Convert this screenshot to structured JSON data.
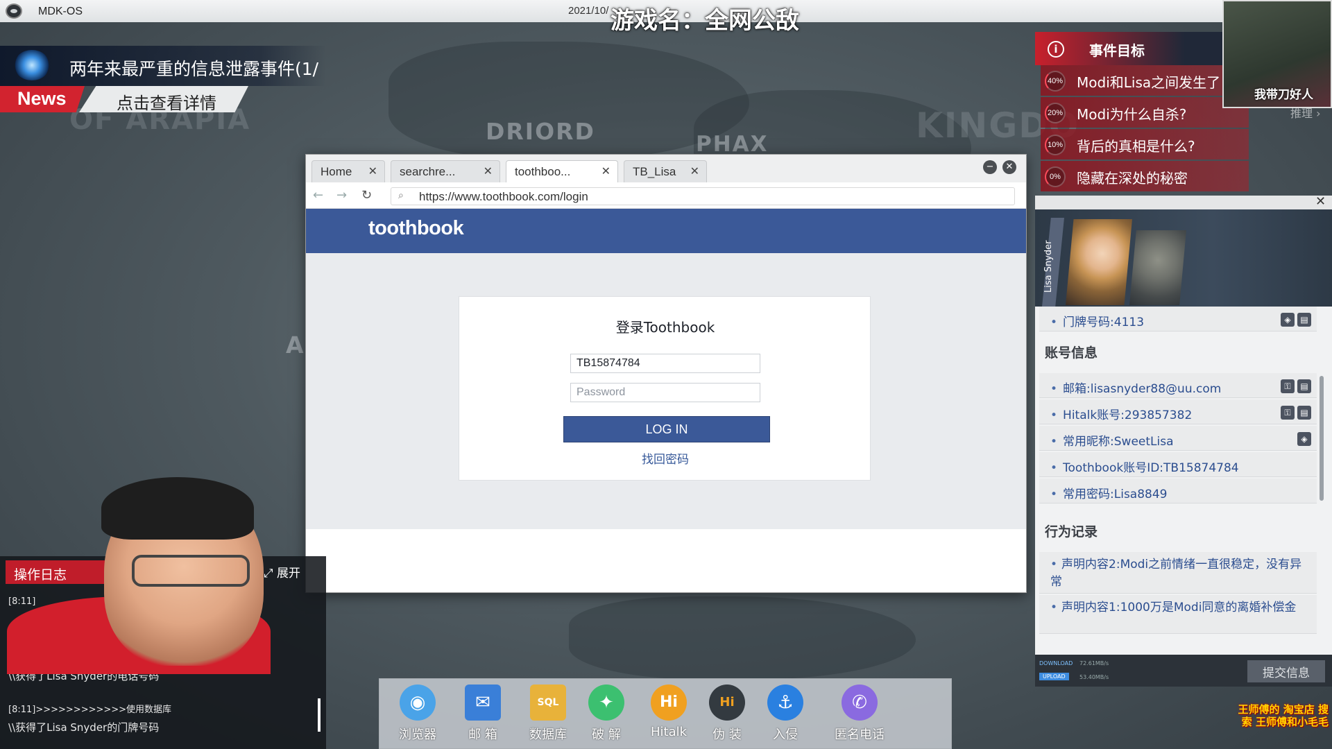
{
  "os": {
    "name": "MDK-OS",
    "datetime": "2021/10/",
    "stream_title": "游戏名：全网公敌"
  },
  "news": {
    "headline": "两年来最严重的信息泄露事件(1/",
    "tag": "News",
    "link": "点击查看详情"
  },
  "map_labels": {
    "driord": "DRIORD",
    "phax": "PHAX",
    "kingdo": "KINGDO",
    "of_arabia": "OF ARAPIA",
    "a": "A"
  },
  "browser": {
    "tabs": [
      {
        "label": "Home",
        "close": "✕"
      },
      {
        "label": "searchre...",
        "close": "✕"
      },
      {
        "label": "toothboo...",
        "close": "✕"
      },
      {
        "label": "TB_Lisa",
        "close": "✕"
      }
    ],
    "url": "https://www.toothbook.com/login",
    "site_logo": "toothbook",
    "login": {
      "title": "登录Toothbook",
      "username_value": "TB15874784",
      "password_placeholder": "Password",
      "button": "LOG IN",
      "forgot": "找回密码"
    }
  },
  "objectives": {
    "title": "事件目标",
    "items": [
      {
        "percent": "40%",
        "text": "Modi和Lisa之间发生了"
      },
      {
        "percent": "20%",
        "text": "Modi为什么自杀?"
      },
      {
        "percent": "10%",
        "text": "背后的真相是什么?"
      },
      {
        "percent": "0%",
        "text": "隐藏在深处的秘密"
      }
    ],
    "reason_link": "推理 ›"
  },
  "thumbnail": {
    "caption": "我带刀好人"
  },
  "profile": {
    "vertical_name": "Lisa Snyder",
    "close": "✕",
    "address_item": "门牌号码:4113",
    "account_heading": "账号信息",
    "account_items": [
      "邮箱:lisasnyder88@uu.com",
      "Hitalk账号:293857382",
      "常用昵称:SweetLisa",
      "Toothbook账号ID:TB15874784",
      "常用密码:Lisa8849"
    ],
    "behavior_heading": "行为记录",
    "behavior_items": [
      "声明内容2:Modi之前情绪一直很稳定，没有异常",
      "声明内容1:1000万是Modi同意的离婚补偿金"
    ],
    "download_label": "DOWNLOAD",
    "download_speed": "72.61MB/s",
    "upload_label": "UPLOAD",
    "upload_speed": "53.40MB/s",
    "submit": "提交信息"
  },
  "log": {
    "title": "操作日志",
    "expand": "⤢ 展开",
    "lines": [
      "[8:11]",
      "\\\\获得了Lisa Snyder的电话号码",
      "[8:11]>>>>>>>>>>>>使用数据库",
      "\\\\获得了Lisa Snyder的门牌号码"
    ]
  },
  "dock": [
    {
      "label": "浏览器",
      "glyph": "◉",
      "color": "#4aa3e8"
    },
    {
      "label": "邮 箱",
      "glyph": "✉",
      "color": "#3a7fd8"
    },
    {
      "label": "数据库",
      "glyph": "SQL",
      "color": "#e8b23a"
    },
    {
      "label": "破 解",
      "glyph": "✦",
      "color": "#3cc070"
    },
    {
      "label": "Hitalk",
      "glyph": "Hi",
      "color": "#f0a020"
    },
    {
      "label": "伪 装",
      "glyph": "Hi",
      "color": "#333a40"
    },
    {
      "label": "入侵",
      "glyph": "⚓",
      "color": "#2a80e0"
    },
    {
      "label": "匿名电话",
      "glyph": "✆",
      "color": "#8a6ae0"
    }
  ],
  "watermark": "王师傅的 淘宝店 搜索 王师傅和小毛毛",
  "colors": {
    "toothbook_blue": "#3b5998",
    "accent_red": "#c8202c",
    "link_blue": "#2b4d8f"
  }
}
